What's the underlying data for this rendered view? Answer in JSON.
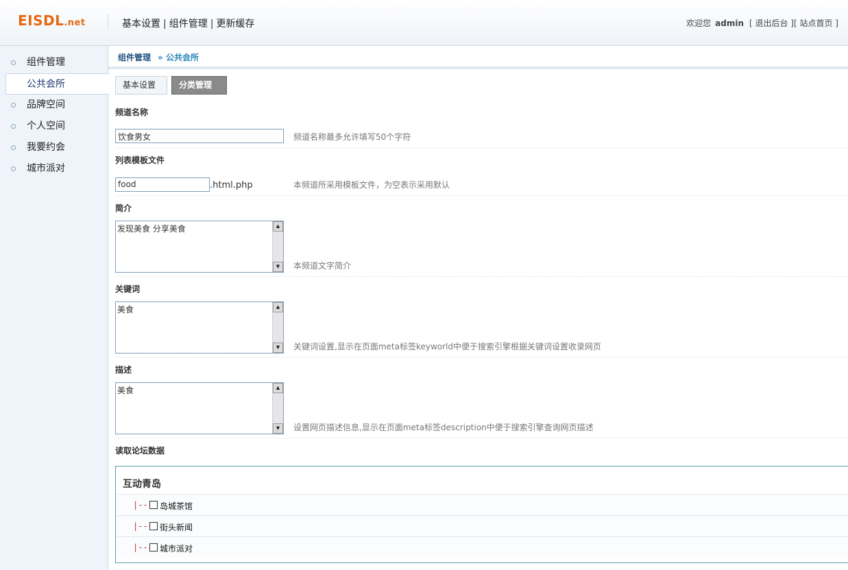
{
  "header": {
    "logo_main": "EISDL",
    "logo_suffix": ".net",
    "nav": [
      "基本设置",
      "组件管理",
      "更新缓存"
    ],
    "welcome": "欢迎您",
    "username": "admin",
    "logout": "[ 退出后台 ]",
    "site_home": "[ 站点首页 ]"
  },
  "sidebar": {
    "items": [
      {
        "label": "组件管理"
      },
      {
        "label": "公共会所"
      },
      {
        "label": "品牌空间"
      },
      {
        "label": "个人空间"
      },
      {
        "label": "我要约会"
      },
      {
        "label": "城市派对"
      }
    ]
  },
  "breadcrumb": {
    "level1": "组件管理",
    "level2": "» 公共会所"
  },
  "tabs": {
    "basic": "基本设置",
    "category": "分类管理"
  },
  "form": {
    "channel_name": {
      "label": "频道名称",
      "value": "饮食男女",
      "hint": "频道名称最多允许填写50个字符"
    },
    "template": {
      "label": "列表模板文件",
      "value": "food",
      "suffix": ".html.php",
      "hint": "本频道所采用模板文件，为空表示采用默认"
    },
    "intro": {
      "label": "简介",
      "value": "发现美食 分享美食",
      "hint": "本频道文字简介"
    },
    "keywords": {
      "label": "关键词",
      "value": "美食",
      "hint": "关键词设置,显示在页面meta标签keyworld中便于搜索引擎根据关键词设置收录网页"
    },
    "description": {
      "label": "描述",
      "value": "美食",
      "hint": "设置网页描述信息,显示在页面meta标签description中便于搜索引擎查询网页描述"
    },
    "forum": {
      "label": "读取论坛数据",
      "group": "互动青岛",
      "prefix": "|---",
      "boards": [
        "岛城茶馆",
        "街头新闻",
        "城市派对"
      ]
    }
  }
}
